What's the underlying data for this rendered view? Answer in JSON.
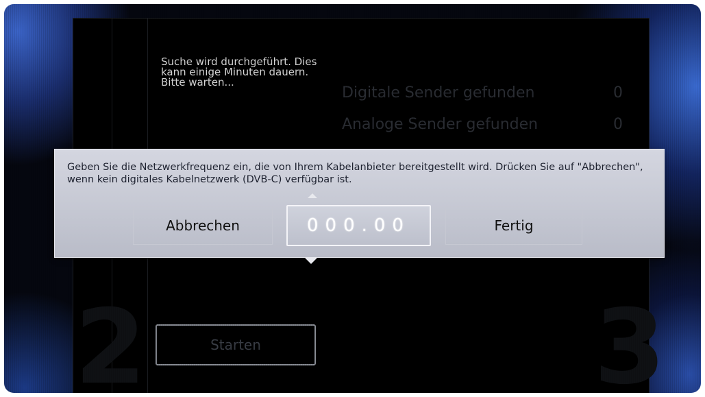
{
  "search": {
    "message": "Suche wird durchgeführt. Dies kann einige Minuten dauern. Bitte warten...",
    "digital_label": "Digitale Sender gefunden",
    "digital_count": "0",
    "analog_label": "Analoge Sender gefunden",
    "analog_count": "0"
  },
  "steps": {
    "left_number": "2",
    "right_number": "3"
  },
  "start_button": "Starten",
  "dialog": {
    "message": "Geben Sie die Netzwerkfrequenz ein, die von Ihrem Kabelanbieter bereitgestellt wird. Drücken Sie auf \"Abbrechen\", wenn kein digitales Kabelnetzwerk (DVB-C) verfügbar ist.",
    "cancel_label": "Abbrechen",
    "frequency_value": "000.00",
    "done_label": "Fertig"
  }
}
